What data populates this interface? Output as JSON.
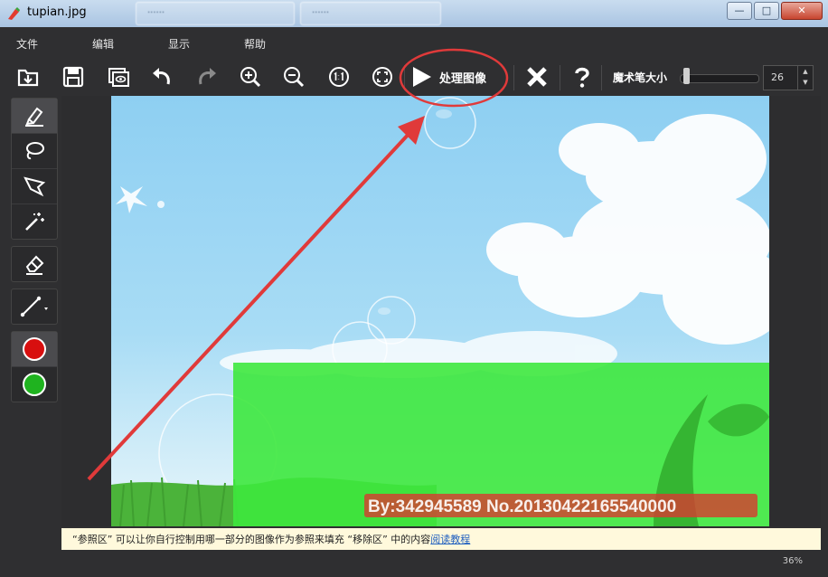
{
  "window": {
    "title": "tupian.jpg",
    "background_tabs": [
      "······",
      "······"
    ],
    "buttons": {
      "minimize": "—",
      "maximize": "□",
      "close": "✕"
    }
  },
  "menu": {
    "items": [
      "文件",
      "编辑",
      "显示",
      "帮助"
    ]
  },
  "toolbar": {
    "process_label": "处理图像",
    "brush_size_label": "魔术笔大小",
    "brush_size_value": "26",
    "brush_size_level": 0.02,
    "icons": [
      "open-icon",
      "save-icon",
      "preview-icon",
      "undo-icon",
      "redo-icon",
      "zoom-in-icon",
      "zoom-out-icon",
      "actual-size-icon",
      "fit-screen-icon",
      "play-icon",
      "cancel-icon",
      "help-icon"
    ]
  },
  "sidebar": {
    "tools": [
      "marker-icon",
      "lasso-icon",
      "polygon-lasso-icon",
      "magic-wand-icon",
      "eraser-icon",
      "line-icon"
    ],
    "colors": [
      "#d80f0f",
      "#1fb31f"
    ]
  },
  "canvas": {
    "watermark": "By:342945589  No.20130422165540000",
    "mask_color": "#3ee83e",
    "annotation_color": "#e03a3a"
  },
  "infobar": {
    "text": "“参照区” 可以让你自行控制用哪一部分的图像作为参照来填充 “移除区” 中的内容",
    "link": "阅读教程"
  },
  "status": {
    "zoom": "36%"
  }
}
